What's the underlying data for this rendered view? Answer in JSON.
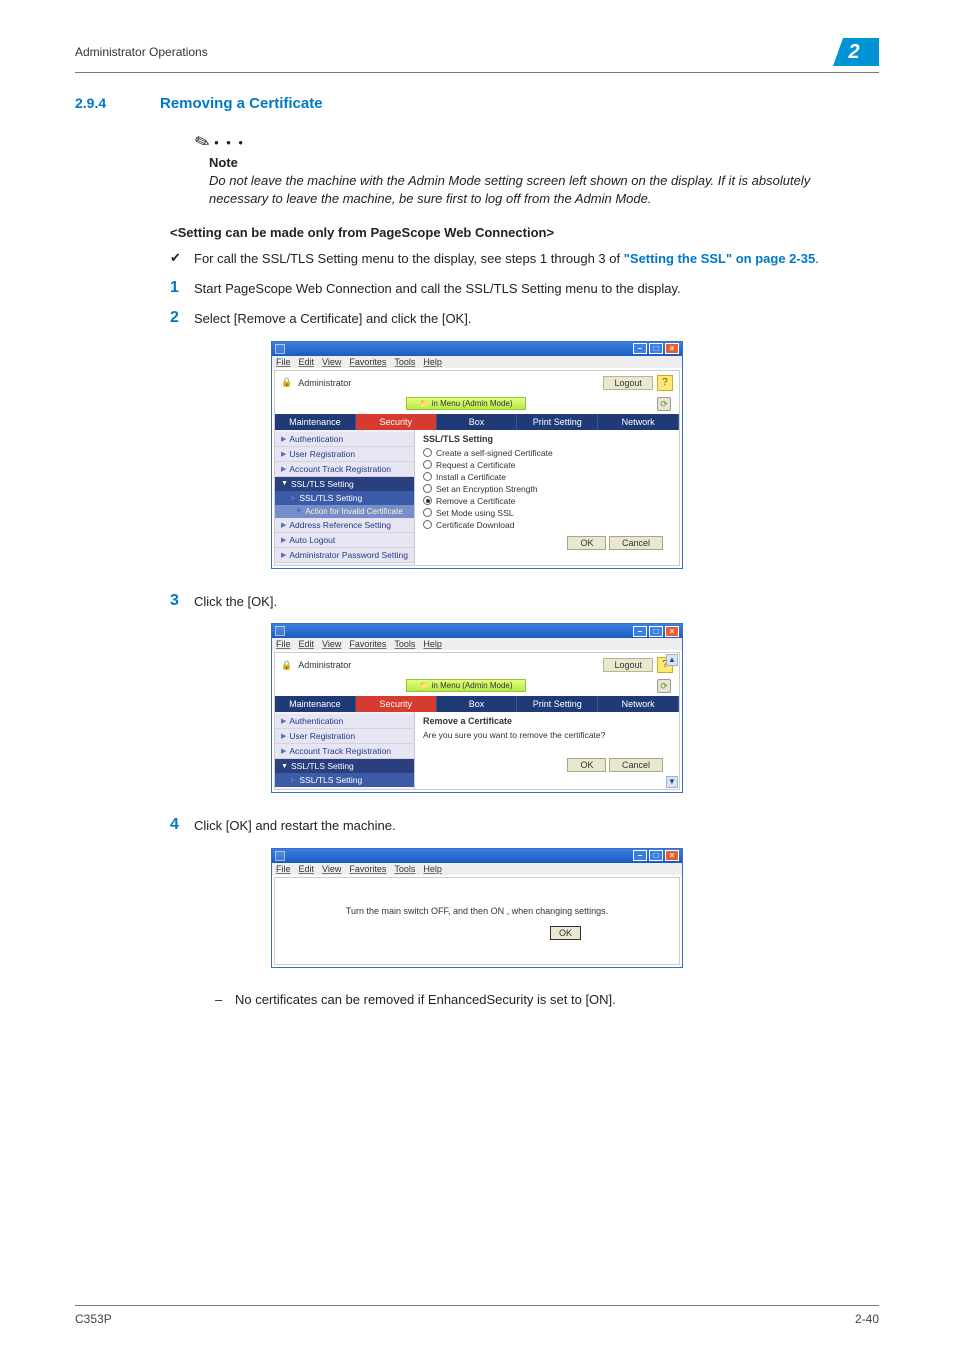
{
  "header": {
    "title": "Administrator Operations",
    "chapter": "2"
  },
  "section": {
    "num": "2.9.4",
    "title": "Removing a Certificate"
  },
  "note": {
    "label": "Note",
    "body": "Do not leave the machine with the Admin Mode setting screen left shown on the display. If it is absolutely necessary to leave the machine, be sure first to log off from the Admin Mode."
  },
  "subsection": "<Setting can be made only from PageScope Web Connection>",
  "bullet": {
    "pre": "For call the SSL/TLS Setting menu to the display, see steps 1 through 3 of ",
    "link": "\"Setting the SSL\" on page 2-35",
    "post": "."
  },
  "steps": {
    "s1": "Start PageScope Web Connection and call the SSL/TLS Setting menu to the display.",
    "s2": "Select [Remove a Certificate] and click the [OK].",
    "s3": "Click the [OK].",
    "s4": "Click [OK] and restart the machine."
  },
  "dash_note": "No certificates can be removed if EnhancedSecurity is set to [ON].",
  "win": {
    "menu": {
      "file": "File",
      "edit": "Edit",
      "view": "View",
      "favorites": "Favorites",
      "tools": "Tools",
      "help": "Help"
    },
    "admin": "Administrator",
    "submenu": "in Menu (Admin Mode)",
    "logout": "Logout",
    "tabs": {
      "maintenance": "Maintenance",
      "security": "Security",
      "box": "Box",
      "print": "Print Setting",
      "network": "Network"
    },
    "nav": {
      "auth": "Authentication",
      "userreg": "User Registration",
      "accttrack": "Account Track Registration",
      "ssltls": "SSL/TLS Setting",
      "ssltls_sub": "SSL/TLS Setting",
      "action_invalid": "Action for Invalid Certificate",
      "addrref": "Address Reference Setting",
      "autologout": "Auto Logout",
      "adminpw": "Administrator Password Setting"
    },
    "content1": {
      "title": "SSL/TLS Setting",
      "opts": {
        "o1": "Create a self-signed Certificate",
        "o2": "Request a Certificate",
        "o3": "Install a Certificate",
        "o4": "Set an Encryption Strength",
        "o5": "Remove a Certificate",
        "o6": "Set Mode using SSL",
        "o7": "Certificate Download"
      }
    },
    "content2": {
      "title": "Remove a Certificate",
      "confirm": "Are you sure you want to remove the certificate?"
    },
    "content3": {
      "msg": "Turn the main switch OFF, and then ON , when changing settings."
    },
    "ok": "OK",
    "cancel": "Cancel"
  },
  "footer": {
    "left": "C353P",
    "right": "2-40"
  }
}
